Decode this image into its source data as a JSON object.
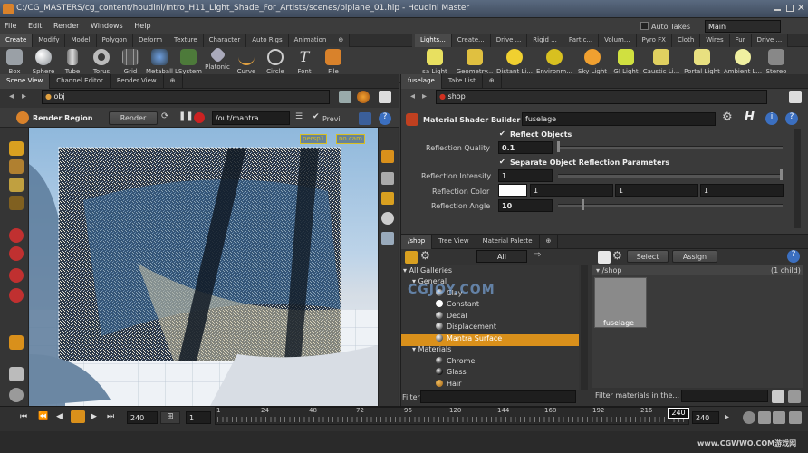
{
  "window": {
    "title": "C:/CG_MASTERS/cg_content/houdini/Intro_H11_Light_Shade_For_Artists/scenes/biplane_01.hip - Houdini Master"
  },
  "menu": {
    "items": [
      "File",
      "Edit",
      "Render",
      "Windows",
      "Help"
    ],
    "auto_takes": "Auto Takes",
    "desktop": "Main"
  },
  "shelf_left": {
    "tabs": [
      "Create",
      "Modify",
      "Model",
      "Polygon",
      "Deform",
      "Texture",
      "Character",
      "Auto Rigs",
      "Animation"
    ],
    "tools": [
      "Box",
      "Sphere",
      "Tube",
      "Torus",
      "Grid",
      "Metaball",
      "LSystem",
      "Platonic ...",
      "Curve",
      "Circle",
      "Font",
      "File"
    ]
  },
  "shelf_right": {
    "tabs": [
      "Lights...",
      "Create...",
      "Drive ...",
      "Rigid ...",
      "Partic...",
      "Volum...",
      "Pyro FX",
      "Cloth",
      "Wires",
      "Fur",
      "Drive ..."
    ],
    "tools": [
      "sa Light",
      "Geometry...",
      "Distant Li...",
      "Environm...",
      "Sky Light",
      "GI Light",
      "Caustic Li...",
      "Portal Light",
      "Ambient L...",
      "Stereo"
    ]
  },
  "left_pane": {
    "tabs": [
      "Scene View",
      "Channel Editor",
      "Render View"
    ],
    "path": "obj",
    "toolbar": {
      "title": "Render Region",
      "render_label": "Render",
      "output": "/out/mantra...",
      "preview": "Previ"
    },
    "camera": "persp1",
    "cam_menu": "no cam"
  },
  "param_pane": {
    "tabs": [
      "fuselage",
      "Take List"
    ],
    "path": "shop",
    "node_type": "Material Shader Builder",
    "node_name": "fuselage",
    "reflect_objects": "Reflect Objects",
    "reflection_quality_label": "Reflection Quality",
    "reflection_quality": "0.1",
    "separate_label": "Separate Object Reflection Parameters",
    "reflection_intensity_label": "Reflection Intensity",
    "reflection_intensity": "1",
    "reflection_color_label": "Reflection Color",
    "reflection_color": [
      "1",
      "1",
      "1"
    ],
    "reflection_angle_label": "Reflection Angle",
    "reflection_angle": "10"
  },
  "palette_pane": {
    "tabs": [
      "/shop",
      "Tree View",
      "Material Palette"
    ],
    "filter_all": "All",
    "select": "Select",
    "assign": "Assign",
    "tree": [
      {
        "label": "All Galleries",
        "depth": 0,
        "kind": "folder"
      },
      {
        "label": "General",
        "depth": 1,
        "kind": "folder"
      },
      {
        "label": "Clay",
        "depth": 2,
        "kind": "material"
      },
      {
        "label": "Constant",
        "depth": 2,
        "kind": "material"
      },
      {
        "label": "Decal",
        "depth": 2,
        "kind": "material"
      },
      {
        "label": "Displacement",
        "depth": 2,
        "kind": "material"
      },
      {
        "label": "Mantra Surface",
        "depth": 2,
        "kind": "material",
        "selected": true
      },
      {
        "label": "Materials",
        "depth": 1,
        "kind": "folder"
      },
      {
        "label": "Chrome",
        "depth": 2,
        "kind": "material"
      },
      {
        "label": "Glass",
        "depth": 2,
        "kind": "material"
      },
      {
        "label": "Hair",
        "depth": 2,
        "kind": "material"
      }
    ],
    "filter_label": "Filter",
    "shop_path": "/shop",
    "child_count": "(1 child)",
    "material_card": "fuselage",
    "filter_materials": "Filter materials in the..."
  },
  "timeline": {
    "frame": "240",
    "start": "1",
    "ticks": [
      "1",
      "24",
      "48",
      "72",
      "96",
      "120",
      "144",
      "168",
      "192",
      "216"
    ],
    "current": "240",
    "end": "240"
  },
  "watermark": {
    "text": "CGJOY.COM",
    "url": "www.CGWWO.COM游戏网"
  },
  "colors": {
    "accent": "#d9901b",
    "selection": "#d9901b",
    "titlebar": "#4a5a70"
  }
}
